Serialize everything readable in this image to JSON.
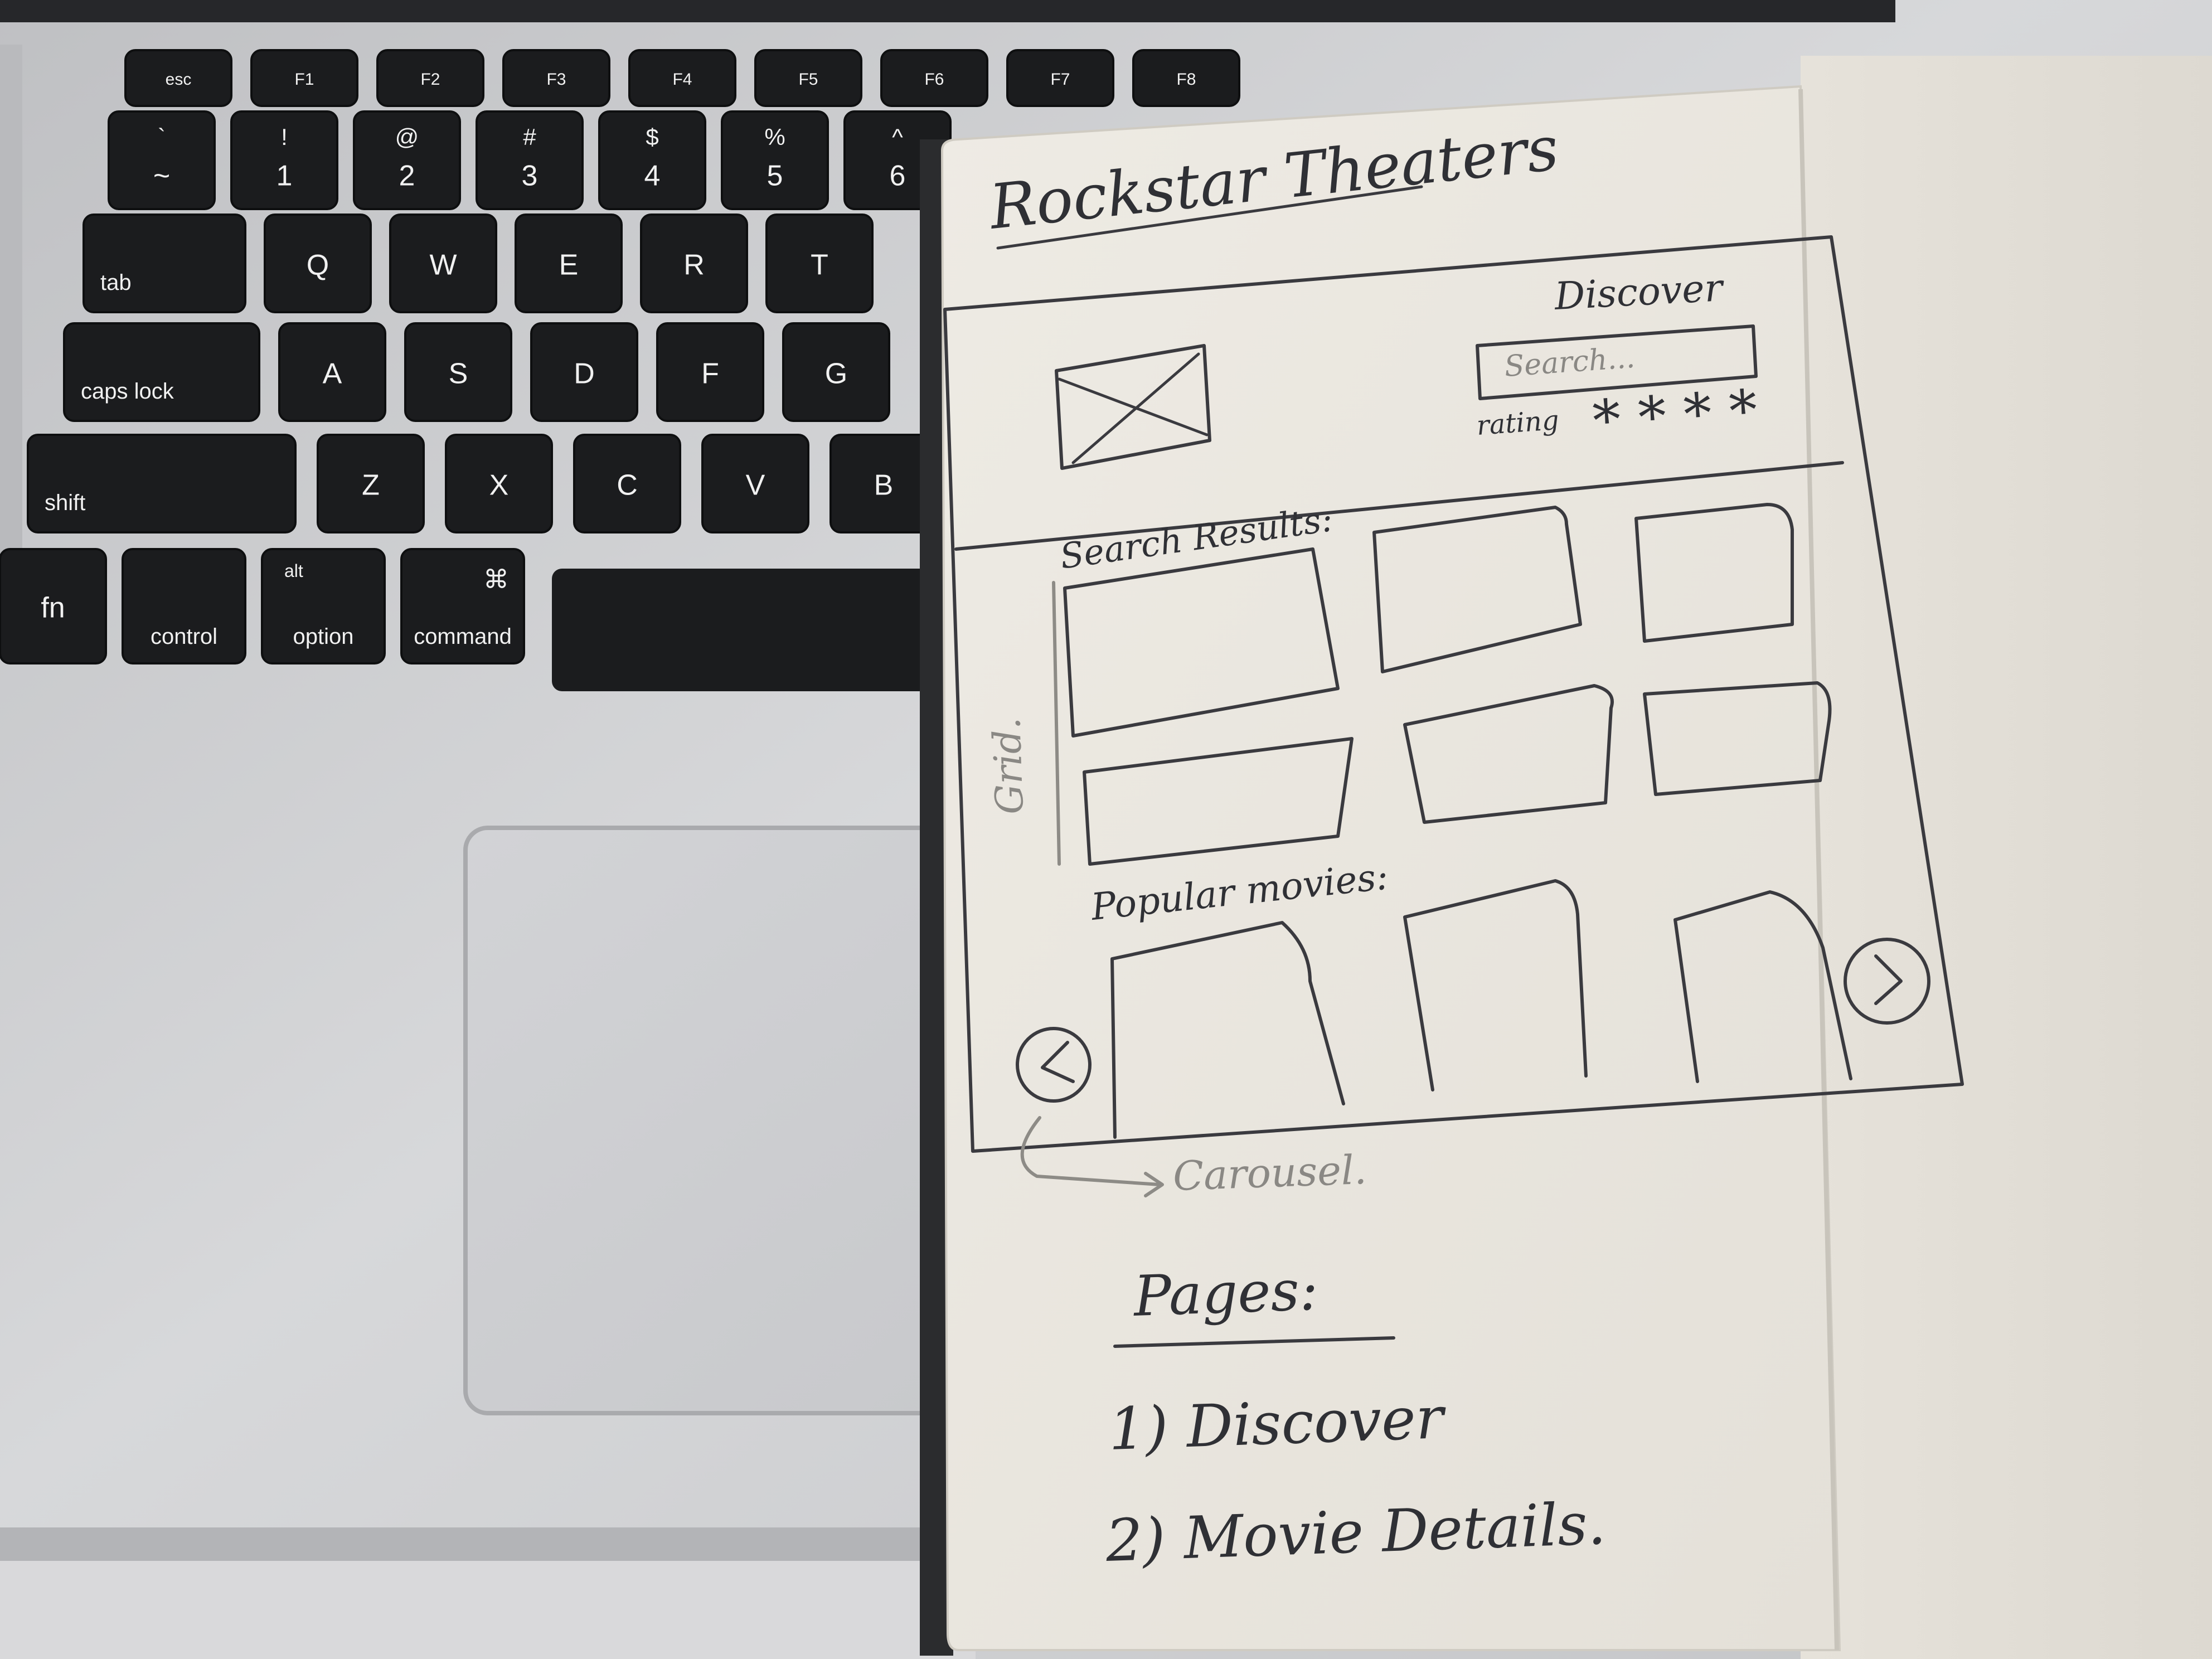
{
  "keyboard": {
    "rows": [
      [
        "esc",
        "F1",
        "F2",
        "F3",
        "F4",
        "F5",
        "F6",
        "F7",
        "F8"
      ],
      [
        "~",
        "1",
        "2",
        "3",
        "4",
        "5",
        "6"
      ],
      [
        "tab",
        "Q",
        "W",
        "E",
        "R",
        "T"
      ],
      [
        "caps lock",
        "A",
        "S",
        "D",
        "F",
        "G"
      ],
      [
        "shift",
        "Z",
        "X",
        "C",
        "V",
        "B"
      ],
      [
        "fn",
        "control",
        "option",
        "command"
      ]
    ],
    "top_row_symbols": [
      "`",
      "!",
      "@",
      "#",
      "$",
      "%",
      "^"
    ],
    "modifier_glyphs": {
      "option_top": "alt",
      "command_top": "⌘"
    }
  },
  "sketch": {
    "title": "Rockstar Theaters",
    "header": {
      "nav_label": "Discover",
      "search_placeholder": "Search...",
      "rating_label": "rating",
      "rating_stars": "* * * *",
      "image_placeholder_icon": "image-placeholder-x-icon"
    },
    "search_results": {
      "heading": "Search Results:",
      "side_note": "Grid."
    },
    "popular": {
      "heading": "Popular movies:",
      "prev_icon": "chevron-left-icon",
      "next_icon": "chevron-right-icon",
      "annotation": "Carousel."
    },
    "pages": {
      "heading": "Pages:",
      "items": [
        "1) Discover",
        "2) Movie Details."
      ]
    }
  },
  "colors": {
    "aluminium": "#cfd0d2",
    "key": "#1b1c1e",
    "paper": "#ebe8e1",
    "ink": "#2f3035",
    "pencil": "#8d8b86"
  }
}
